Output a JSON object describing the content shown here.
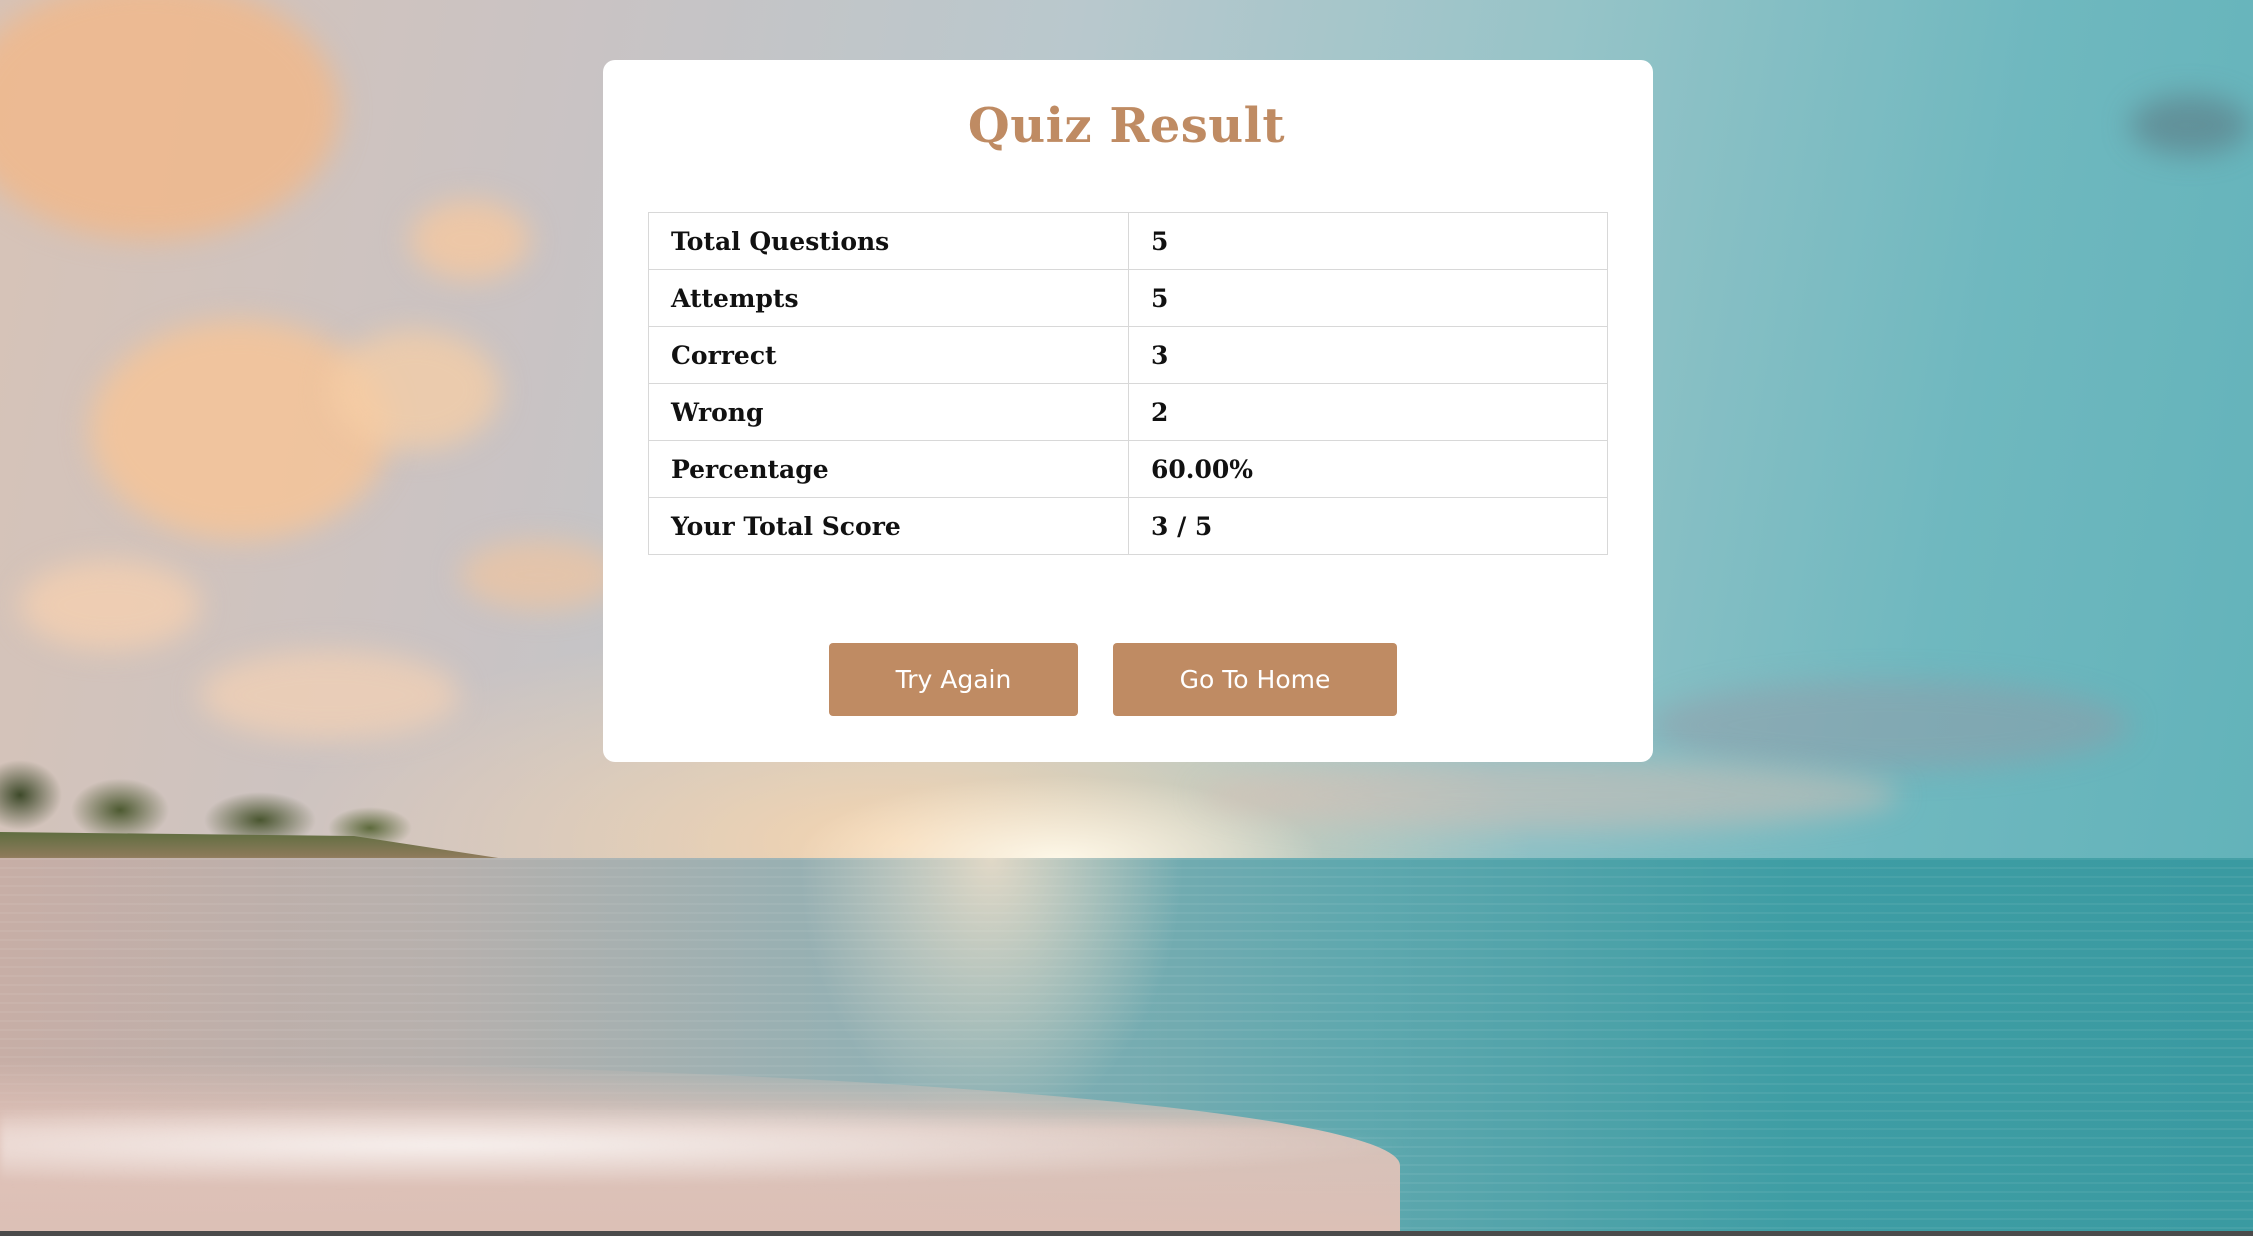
{
  "title": "Quiz Result",
  "results": [
    {
      "label": "Total Questions",
      "value": "5"
    },
    {
      "label": "Attempts",
      "value": "5"
    },
    {
      "label": "Correct",
      "value": "3"
    },
    {
      "label": "Wrong",
      "value": "2"
    },
    {
      "label": "Percentage",
      "value": "60.00%"
    },
    {
      "label": "Your Total Score",
      "value": "3 / 5"
    }
  ],
  "buttons": {
    "try_again": "Try Again",
    "go_home": "Go To Home"
  },
  "colors": {
    "accent": "#bf8b63",
    "card_bg": "#ffffff",
    "table_border": "#d8d8d8"
  }
}
